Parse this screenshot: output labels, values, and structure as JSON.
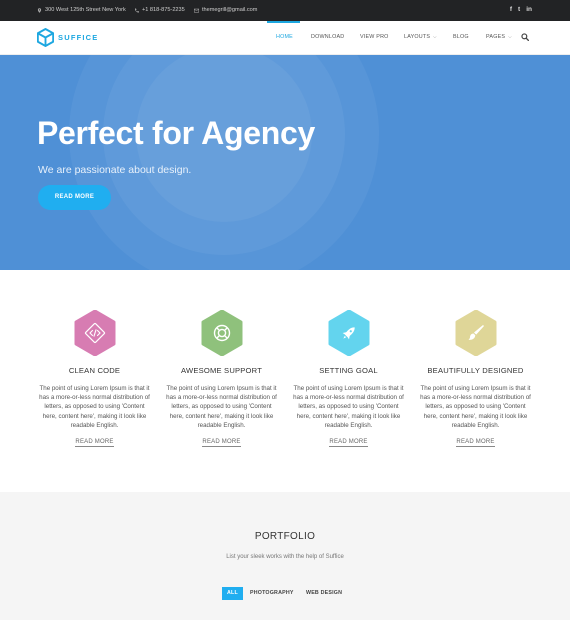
{
  "topbar": {
    "address": "300 West 125th Street New York",
    "phone": "+1 818-875-2235",
    "email": "themegrill@gmail.com",
    "social": [
      "f",
      "t",
      "in"
    ]
  },
  "header": {
    "logo_text": "SUFFICE",
    "nav": [
      {
        "label": "HOME",
        "active": true
      },
      {
        "label": "DOWNLOAD"
      },
      {
        "label": "VIEW PRO"
      },
      {
        "label": "LAYOUTS",
        "dropdown": true
      },
      {
        "label": "BLOG"
      },
      {
        "label": "PAGES",
        "dropdown": true
      }
    ],
    "search_icon": "search-icon"
  },
  "hero": {
    "title": "Perfect for Agency",
    "subtitle": "We are passionate about design.",
    "button": "READ MORE"
  },
  "features": [
    {
      "title": "CLEAN CODE",
      "icon": "code-icon",
      "color": "#d77cb2",
      "desc": "The point of using Lorem Ipsum is that it has a more-or-less normal distribution of letters, as opposed to using 'Content here, content here', making it look like readable English.",
      "more": "READ MORE"
    },
    {
      "title": "AWESOME SUPPORT",
      "icon": "lifebuoy-icon",
      "color": "#8fc17c",
      "desc": "The point of using Lorem Ipsum is that it has a more-or-less normal distribution of letters, as opposed to using 'Content here, content here', making it look like readable English.",
      "more": "READ MORE"
    },
    {
      "title": "SETTING GOAL",
      "icon": "rocket-icon",
      "color": "#63d4ee",
      "desc": "The point of using Lorem Ipsum is that it has a more-or-less normal distribution of letters, as opposed to using 'Content here, content here', making it look like readable English.",
      "more": "READ MORE"
    },
    {
      "title": "BEAUTIFULLY DESIGNED",
      "icon": "brush-icon",
      "color": "#dfd698",
      "desc": "The point of using Lorem Ipsum is that it has a more-or-less normal distribution of letters, as opposed to using 'Content here, content here', making it look like readable English.",
      "more": "READ MORE"
    }
  ],
  "portfolio": {
    "title": "PORTFOLIO",
    "subtitle": "List your sleek works with the help of Suffice",
    "filters": [
      "ALL",
      "PHOTOGRAPHY",
      "WEB DESIGN"
    ]
  },
  "colors": {
    "accent": "#1da7e0",
    "hero_bg": "#4f90d6",
    "topbar_bg": "#222325"
  }
}
